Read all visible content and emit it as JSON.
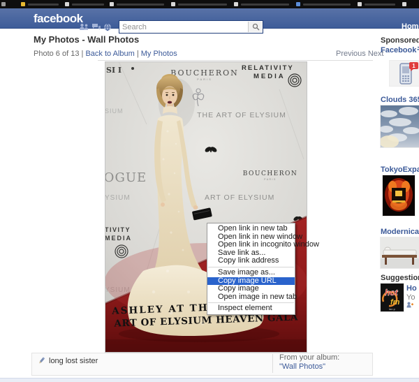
{
  "browser": {
    "tab_fav_styles": [
      "background:#9a9a9a",
      "background:#e8b931",
      "background:#d8d8d8",
      "background:#d8d8d8",
      "background:#d8d8d8",
      "background:#d8d8d8",
      "background:#5b8dd9",
      "background:#d8d8d8",
      "background:#d8d8d8"
    ]
  },
  "header": {
    "logo": "facebook",
    "search_placeholder": "Search",
    "home_label": "Home"
  },
  "page": {
    "title": "My Photos - Wall Photos",
    "photo_position": "Photo 6 of 13",
    "back_link": "Back to Album",
    "my_photos_link": "My Photos",
    "prev_link": "Previous",
    "next_link": "Next",
    "caption": "long lost sister",
    "album_label": "From your album:",
    "album_link": "\"Wall Photos\""
  },
  "photo": {
    "backdrop": {
      "partial_top_left": "SI I",
      "boucheron": "BOUCHERON",
      "paris": "PARIS",
      "relativity": "RELATIVITY",
      "media": "MEDIA",
      "the_art_of_elysium": "THE ART OF ELYSIUM",
      "sium": "SIUM",
      "vogue": "VOGUE",
      "boucheron2": "BOUCHERON",
      "paris2": "PARIS",
      "ysium": "YSIUM",
      "art_of_elysium": "ART OF ELYSIUM",
      "tivity": "TIVITY",
      "media2": "MEDIA",
      "ysium2": "YSIUM"
    },
    "caption_line1": "ASHLEY AT THE",
    "caption_line2": "ART OF ELYSIUM HEAVEN GALA"
  },
  "context_menu": {
    "items": [
      "Open link in new tab",
      "Open link in new window",
      "Open link in incognito window",
      "Save link as...",
      "Copy link address",
      "Save image as...",
      "Copy image URL",
      "Copy image",
      "Open image in new tab",
      "Inspect element"
    ],
    "highlighted_item": "Copy image URL"
  },
  "sidebar": {
    "sponsored_label": "Sponsored",
    "ads": [
      {
        "title": "Facebookモ",
        "image": "mobile-phone-with-notification"
      },
      {
        "title": "Clouds 365",
        "image": "cloudy-sky-photo"
      },
      {
        "title": "TokyoExpat",
        "image": "fiery-crest-emblem"
      },
      {
        "title": "Modernica",
        "image": "daybed-furniture"
      }
    ],
    "suggestions_label": "Suggestions",
    "suggestion": {
      "line1": "Ho",
      "line2": "Yo",
      "logo_hot": "hot",
      "logo_fm": "fm",
      "logo_sub": "tan p"
    }
  },
  "badges": {
    "phone_ad_count": "1"
  },
  "colors": {
    "fb_blue": "#3b5998",
    "menu_highlight": "#2a63cc",
    "carpet_red": "#8e1a1a",
    "link_blue": "#3b5998"
  }
}
